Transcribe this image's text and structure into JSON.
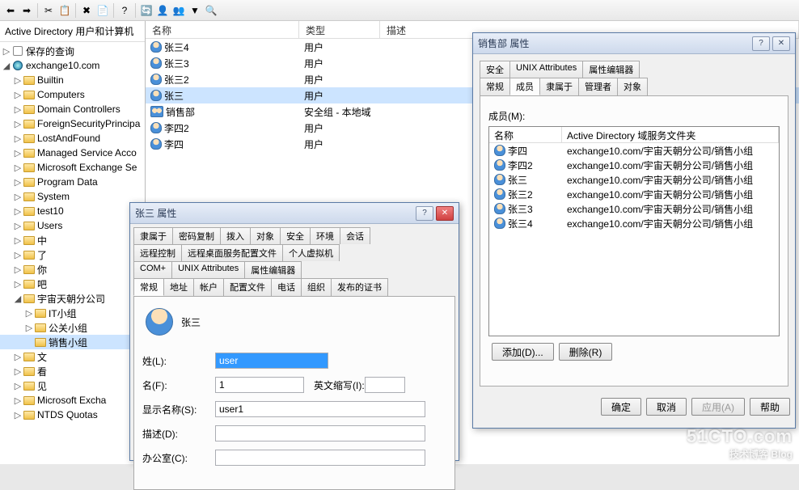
{
  "tree": {
    "header": "Active Directory 用户和计算机",
    "nodes": [
      {
        "label": "保存的查询",
        "indent": 0,
        "tw": "▷",
        "icon": "query"
      },
      {
        "label": "exchange10.com",
        "indent": 0,
        "tw": "◢",
        "icon": "globe"
      },
      {
        "label": "Builtin",
        "indent": 1,
        "tw": "▷",
        "icon": "folder"
      },
      {
        "label": "Computers",
        "indent": 1,
        "tw": "▷",
        "icon": "folder"
      },
      {
        "label": "Domain Controllers",
        "indent": 1,
        "tw": "▷",
        "icon": "folder"
      },
      {
        "label": "ForeignSecurityPrincipa",
        "indent": 1,
        "tw": "▷",
        "icon": "folder"
      },
      {
        "label": "LostAndFound",
        "indent": 1,
        "tw": "▷",
        "icon": "folder"
      },
      {
        "label": "Managed Service Acco",
        "indent": 1,
        "tw": "▷",
        "icon": "folder"
      },
      {
        "label": "Microsoft Exchange Se",
        "indent": 1,
        "tw": "▷",
        "icon": "folder"
      },
      {
        "label": "Program Data",
        "indent": 1,
        "tw": "▷",
        "icon": "folder"
      },
      {
        "label": "System",
        "indent": 1,
        "tw": "▷",
        "icon": "folder"
      },
      {
        "label": "test10",
        "indent": 1,
        "tw": "▷",
        "icon": "folder"
      },
      {
        "label": "Users",
        "indent": 1,
        "tw": "▷",
        "icon": "folder"
      },
      {
        "label": "中",
        "indent": 1,
        "tw": "▷",
        "icon": "folder"
      },
      {
        "label": "了",
        "indent": 1,
        "tw": "▷",
        "icon": "folder"
      },
      {
        "label": "你",
        "indent": 1,
        "tw": "▷",
        "icon": "folder"
      },
      {
        "label": "吧",
        "indent": 1,
        "tw": "▷",
        "icon": "folder"
      },
      {
        "label": "宇宙天朝分公司",
        "indent": 1,
        "tw": "◢",
        "icon": "folder"
      },
      {
        "label": "IT小组",
        "indent": 2,
        "tw": "▷",
        "icon": "folder"
      },
      {
        "label": "公关小组",
        "indent": 2,
        "tw": "▷",
        "icon": "folder"
      },
      {
        "label": "销售小组",
        "indent": 2,
        "tw": " ",
        "icon": "folder",
        "selected": true
      },
      {
        "label": "文",
        "indent": 1,
        "tw": "▷",
        "icon": "folder"
      },
      {
        "label": "看",
        "indent": 1,
        "tw": "▷",
        "icon": "folder"
      },
      {
        "label": "见",
        "indent": 1,
        "tw": "▷",
        "icon": "folder"
      },
      {
        "label": "Microsoft Excha",
        "indent": 1,
        "tw": "▷",
        "icon": "folder"
      },
      {
        "label": "NTDS Quotas",
        "indent": 1,
        "tw": "▷",
        "icon": "folder"
      }
    ]
  },
  "list": {
    "columns": {
      "name": "名称",
      "type": "类型",
      "desc": "描述"
    },
    "rows": [
      {
        "name": "张三4",
        "type": "用户",
        "icon": "user"
      },
      {
        "name": "张三3",
        "type": "用户",
        "icon": "user"
      },
      {
        "name": "张三2",
        "type": "用户",
        "icon": "user"
      },
      {
        "name": "张三",
        "type": "用户",
        "icon": "user",
        "selected": true
      },
      {
        "name": "销售部",
        "type": "安全组 - 本地域",
        "icon": "group"
      },
      {
        "name": "李四2",
        "type": "用户",
        "icon": "user"
      },
      {
        "name": "李四",
        "type": "用户",
        "icon": "user"
      }
    ]
  },
  "userDialog": {
    "title": "张三 属性",
    "tabs_row1": [
      "隶属于",
      "密码复制",
      "拨入",
      "对象",
      "安全",
      "环境",
      "会话"
    ],
    "tabs_row2": [
      "远程控制",
      "远程桌面服务配置文件",
      "个人虚拟机"
    ],
    "tabs_row3": [
      "COM+",
      "UNIX Attributes",
      "属性编辑器"
    ],
    "tabs_row4": [
      "常规",
      "地址",
      "帐户",
      "配置文件",
      "电话",
      "组织",
      "发布的证书"
    ],
    "active_tab": "常规",
    "display_name": "张三",
    "fields": {
      "lastname_label": "姓(L):",
      "lastname_value": "user",
      "firstname_label": "名(F):",
      "firstname_value": "1",
      "initials_label": "英文缩写(I):",
      "initials_value": "",
      "display_label": "显示名称(S):",
      "display_value": "user1",
      "desc_label": "描述(D):",
      "desc_value": "",
      "office_label": "办公室(C):",
      "office_value": ""
    }
  },
  "groupDialog": {
    "title": "销售部 属性",
    "tabs_row1": [
      "安全",
      "UNIX Attributes",
      "属性编辑器"
    ],
    "tabs_row2": [
      "常规",
      "成员",
      "隶属于",
      "管理者",
      "对象"
    ],
    "active_tab": "成员",
    "members_label": "成员(M):",
    "columns": {
      "name": "名称",
      "folder": "Active Directory 域服务文件夹"
    },
    "members": [
      {
        "name": "李四",
        "folder": "exchange10.com/宇宙天朝分公司/销售小组"
      },
      {
        "name": "李四2",
        "folder": "exchange10.com/宇宙天朝分公司/销售小组"
      },
      {
        "name": "张三",
        "folder": "exchange10.com/宇宙天朝分公司/销售小组"
      },
      {
        "name": "张三2",
        "folder": "exchange10.com/宇宙天朝分公司/销售小组"
      },
      {
        "name": "张三3",
        "folder": "exchange10.com/宇宙天朝分公司/销售小组"
      },
      {
        "name": "张三4",
        "folder": "exchange10.com/宇宙天朝分公司/销售小组"
      }
    ],
    "buttons": {
      "add": "添加(D)...",
      "remove": "删除(R)",
      "ok": "确定",
      "cancel": "取消",
      "apply": "应用(A)",
      "help": "帮助"
    }
  },
  "watermark": {
    "big": "51CTO.com",
    "sm": "技术博客  Blog"
  }
}
